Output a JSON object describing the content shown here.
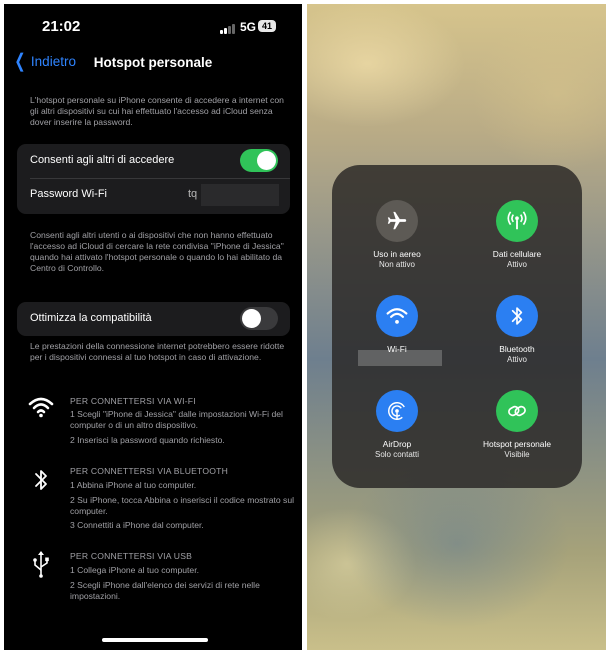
{
  "left": {
    "status": {
      "time": "21:02",
      "network": "5G",
      "battery": "41"
    },
    "nav": {
      "back_label": "Indietro",
      "title": "Hotspot personale"
    },
    "intro": "L'hotspot personale su iPhone consente di accedere a internet con gli altri dispositivi su cui hai effettuato l'accesso ad iCloud senza dover inserire la password.",
    "allow_row": {
      "label": "Consenti agli altri di accedere",
      "on": true
    },
    "password_row": {
      "label": "Password Wi-Fi",
      "value": "tq"
    },
    "allow_note": "Consenti agli altri utenti o ai dispositivi che non hanno effettuato l'accesso ad iCloud di cercare la rete condivisa \"iPhone di Jessica\" quando hai attivato l'hotspot personale o quando lo hai abilitato da Centro di Controllo.",
    "compat_row": {
      "label": "Ottimizza la compatibilità",
      "on": false
    },
    "compat_note": "Le prestazioni della connessione internet potrebbero essere ridotte per i dispositivi connessi al tuo hotspot in caso di attivazione.",
    "wifi": {
      "icon": "wifi-icon",
      "heading": "PER CONNETTERSI VIA WI-FI",
      "step1": "1 Scegli \"iPhone di Jessica\" dalle impostazioni Wi-Fi del computer o di un altro dispositivo.",
      "step2": "2 Inserisci la password quando richiesto."
    },
    "bluetooth": {
      "icon": "bluetooth-icon",
      "heading": "PER CONNETTERSI VIA BLUETOOTH",
      "step1": "1 Abbina iPhone al tuo computer.",
      "step2": "2 Su iPhone, tocca Abbina o inserisci il codice mostrato sul computer.",
      "step3": "3 Connettiti a iPhone dal computer."
    },
    "usb": {
      "icon": "usb-icon",
      "heading": "PER CONNETTERSI VIA USB",
      "step1": "1 Collega iPhone al tuo computer.",
      "step2": "2 Scegli iPhone dall'elenco dei servizi di rete nelle impostazioni."
    }
  },
  "control_center": {
    "airplane": {
      "name": "Uso in aereo",
      "status": "Non attivo",
      "icon": "airplane-icon"
    },
    "cellular": {
      "name": "Dati cellulare",
      "status": "Attivo",
      "icon": "cellular-icon"
    },
    "wifi": {
      "name": "Wi-Fi",
      "status": "",
      "icon": "wifi-icon"
    },
    "bluetooth": {
      "name": "Bluetooth",
      "status": "Attivo",
      "icon": "bluetooth-icon"
    },
    "airdrop": {
      "name": "AirDrop",
      "status": "Solo contatti",
      "icon": "airdrop-icon"
    },
    "hotspot": {
      "name": "Hotspot personale",
      "status": "Visibile",
      "icon": "hotspot-icon"
    }
  },
  "colors": {
    "accent_blue": "#2f84ff",
    "toggle_green": "#30c359",
    "control_blue": "#2b7ff2",
    "control_gray": "#5d5a55"
  }
}
